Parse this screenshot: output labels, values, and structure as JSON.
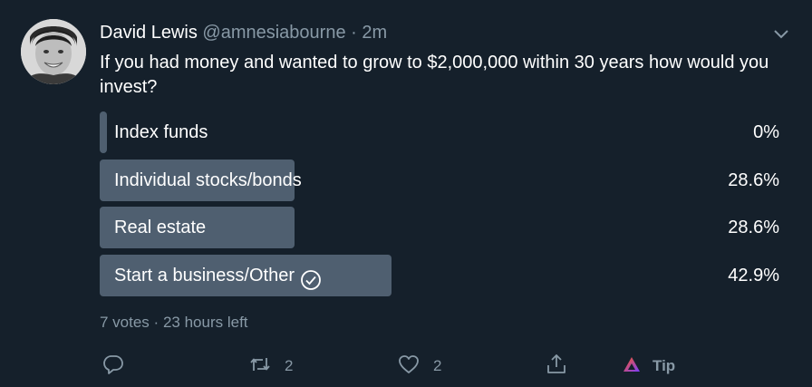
{
  "tweet": {
    "display_name": "David Lewis",
    "handle": "@amnesiabourne",
    "separator": "·",
    "time": "2m",
    "text": "If you had money and wanted to grow to $2,000,000 within 30 years how would you invest?"
  },
  "poll": {
    "options": [
      {
        "label": "Index funds",
        "percent": "0%",
        "value": 0,
        "winner": false
      },
      {
        "label": "Individual stocks/bonds",
        "percent": "28.6%",
        "value": 28.6,
        "winner": false
      },
      {
        "label": "Real estate",
        "percent": "28.6%",
        "value": 28.6,
        "winner": false
      },
      {
        "label": "Start a business/Other",
        "percent": "42.9%",
        "value": 42.9,
        "winner": true
      }
    ],
    "votes": "7 votes",
    "separator": "·",
    "time_left": "23 hours left"
  },
  "actions": {
    "reply_count": "",
    "retweet_count": "2",
    "like_count": "2",
    "tip_label": "Tip"
  },
  "icons": {
    "caret": "chevron-down-icon",
    "reply": "reply-icon",
    "retweet": "retweet-icon",
    "like": "heart-icon",
    "share": "share-icon",
    "tip": "brave-tip-icon",
    "selected": "checkmark-circle-icon"
  },
  "colors": {
    "background": "#15202b",
    "secondary_text": "#8899a6",
    "poll_bar": "#4f5f70"
  }
}
